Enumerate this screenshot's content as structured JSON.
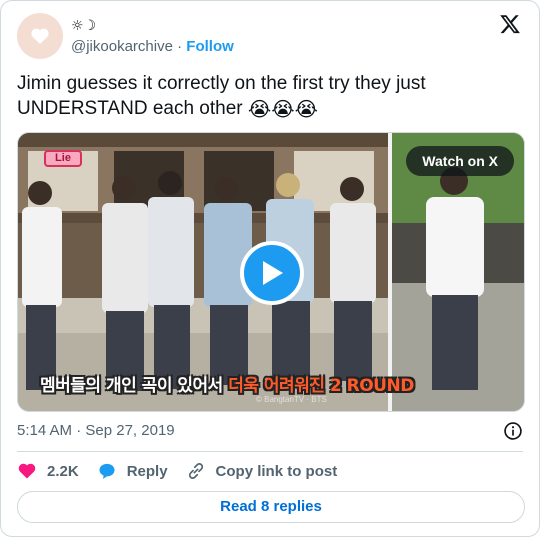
{
  "author": {
    "display_name": "☼☽",
    "handle": "@jikookarchive",
    "separator": "·",
    "follow_label": "Follow"
  },
  "tweet": {
    "text": "Jimin guesses it correctly on the first try they just UNDERSTAND each other",
    "emojis": "😭😭😭"
  },
  "media": {
    "watch_label": "Watch on X",
    "badge": "Lie",
    "caption_white": "멤버들의 개인 곡이 있어서 ",
    "caption_orange": "더욱 어려워진 2 ROUND",
    "watermark": "© BangtanTV · BTS"
  },
  "meta": {
    "time": "5:14 AM",
    "separator": "·",
    "date": "Sep 27, 2019"
  },
  "actions": {
    "likes": "2.2K",
    "reply_label": "Reply",
    "copy_label": "Copy link to post"
  },
  "replies_button": "Read 8 replies",
  "colors": {
    "accent": "#1d9bf0",
    "like": "#f91880",
    "link": "#006fd6",
    "muted": "#536471",
    "border": "#cfd9de"
  },
  "icons": [
    "heart-avatar-icon",
    "x-logo-icon",
    "play-icon",
    "info-icon",
    "heart-icon",
    "reply-bubble-icon",
    "link-icon"
  ]
}
